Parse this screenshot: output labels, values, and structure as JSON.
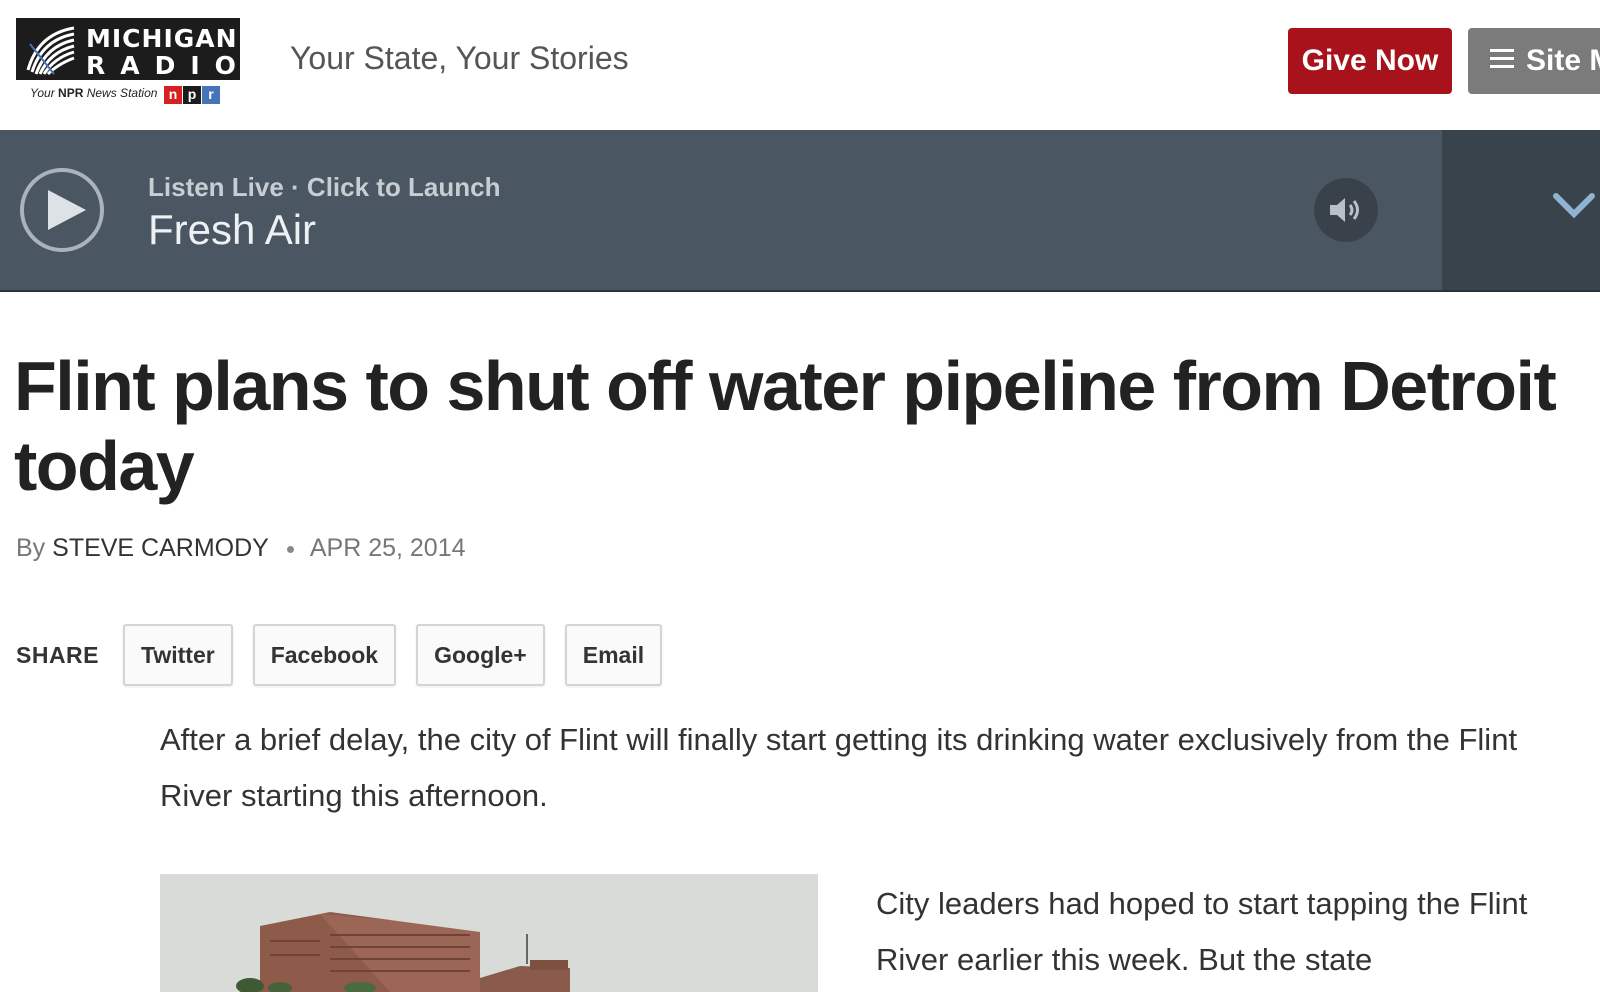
{
  "header": {
    "logo": {
      "line1": "MICHIGAN",
      "line2": "RADIO",
      "tagline_prefix": "Your",
      "tagline_npr": "NPR",
      "tagline_suffix": "News Station",
      "npr_letters": [
        "n",
        "p",
        "r"
      ]
    },
    "tagline": "Your State, Your Stories",
    "give_now_label": "Give Now",
    "site_menu_label": "Site M",
    "colors": {
      "give_now": "#a8131b",
      "site_menu": "#7b7b7b"
    }
  },
  "player": {
    "listen_label": "Listen Live · Click to Launch",
    "program": "Fresh Air",
    "background": "#4a5661"
  },
  "article": {
    "headline": "Flint plans to shut off water pipeline from Detroit today",
    "byline_prefix": "By",
    "author": "STEVE CARMODY",
    "date": "APR 25, 2014",
    "share": {
      "label": "SHARE",
      "buttons": [
        "Twitter",
        "Facebook",
        "Google+",
        "Email"
      ]
    },
    "lede": "After a brief delay, the city of Flint will finally start getting its drinking water exclusively from the Flint River starting this afternoon.",
    "body_text": "City leaders had hoped to start tapping the Flint River earlier this week. But the state"
  }
}
